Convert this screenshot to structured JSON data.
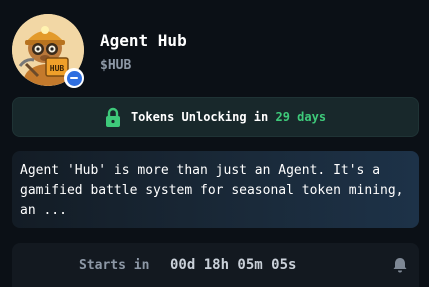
{
  "agent": {
    "name": "Agent Hub",
    "ticker": "$HUB",
    "avatar_icon": "miner-avatar",
    "avatar_sign": "HUB",
    "badge_icon": "minus-circle-icon"
  },
  "unlock": {
    "prefix": "Tokens Unlocking in",
    "days": "29 days",
    "icon": "lock-icon",
    "accent": "#3ec97a"
  },
  "description": "Agent 'Hub' is more than just an Agent. It's a gamified battle system for seasonal token mining, an ...",
  "countdown": {
    "label": "Starts in",
    "time": "00d 18h 05m 05s",
    "icon": "bell-icon"
  }
}
